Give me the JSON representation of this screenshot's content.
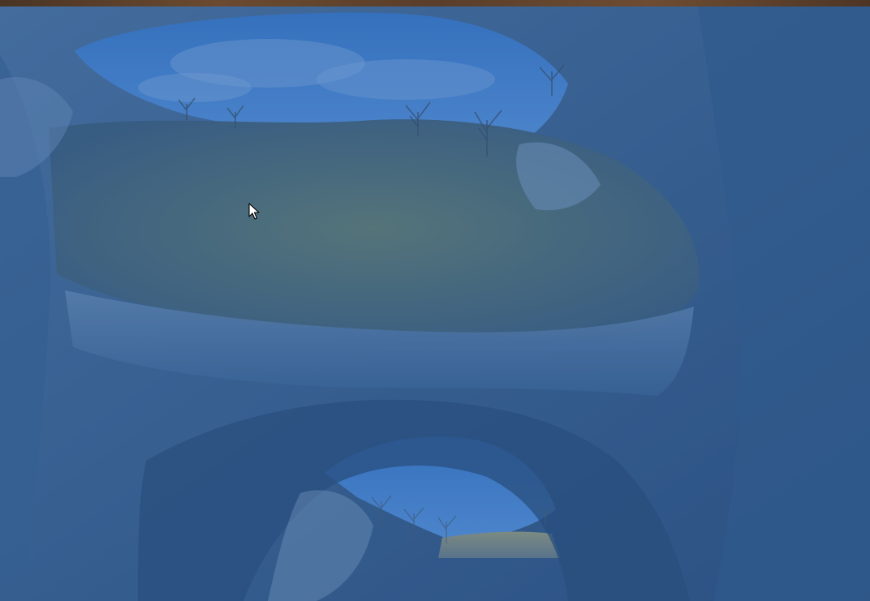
{
  "desktop": {
    "wallpaper_icon": "cave-landscape-wallpaper",
    "cursor_icon": "mouse-pointer-icon"
  },
  "colors": {
    "sky": "#3f7fd0",
    "rock_light": "#6f8fb3",
    "rock_mid": "#4a6d96",
    "rock_dark": "#2b4a72",
    "moss": "#5a7565",
    "top_strip": "#5a3e2a"
  }
}
